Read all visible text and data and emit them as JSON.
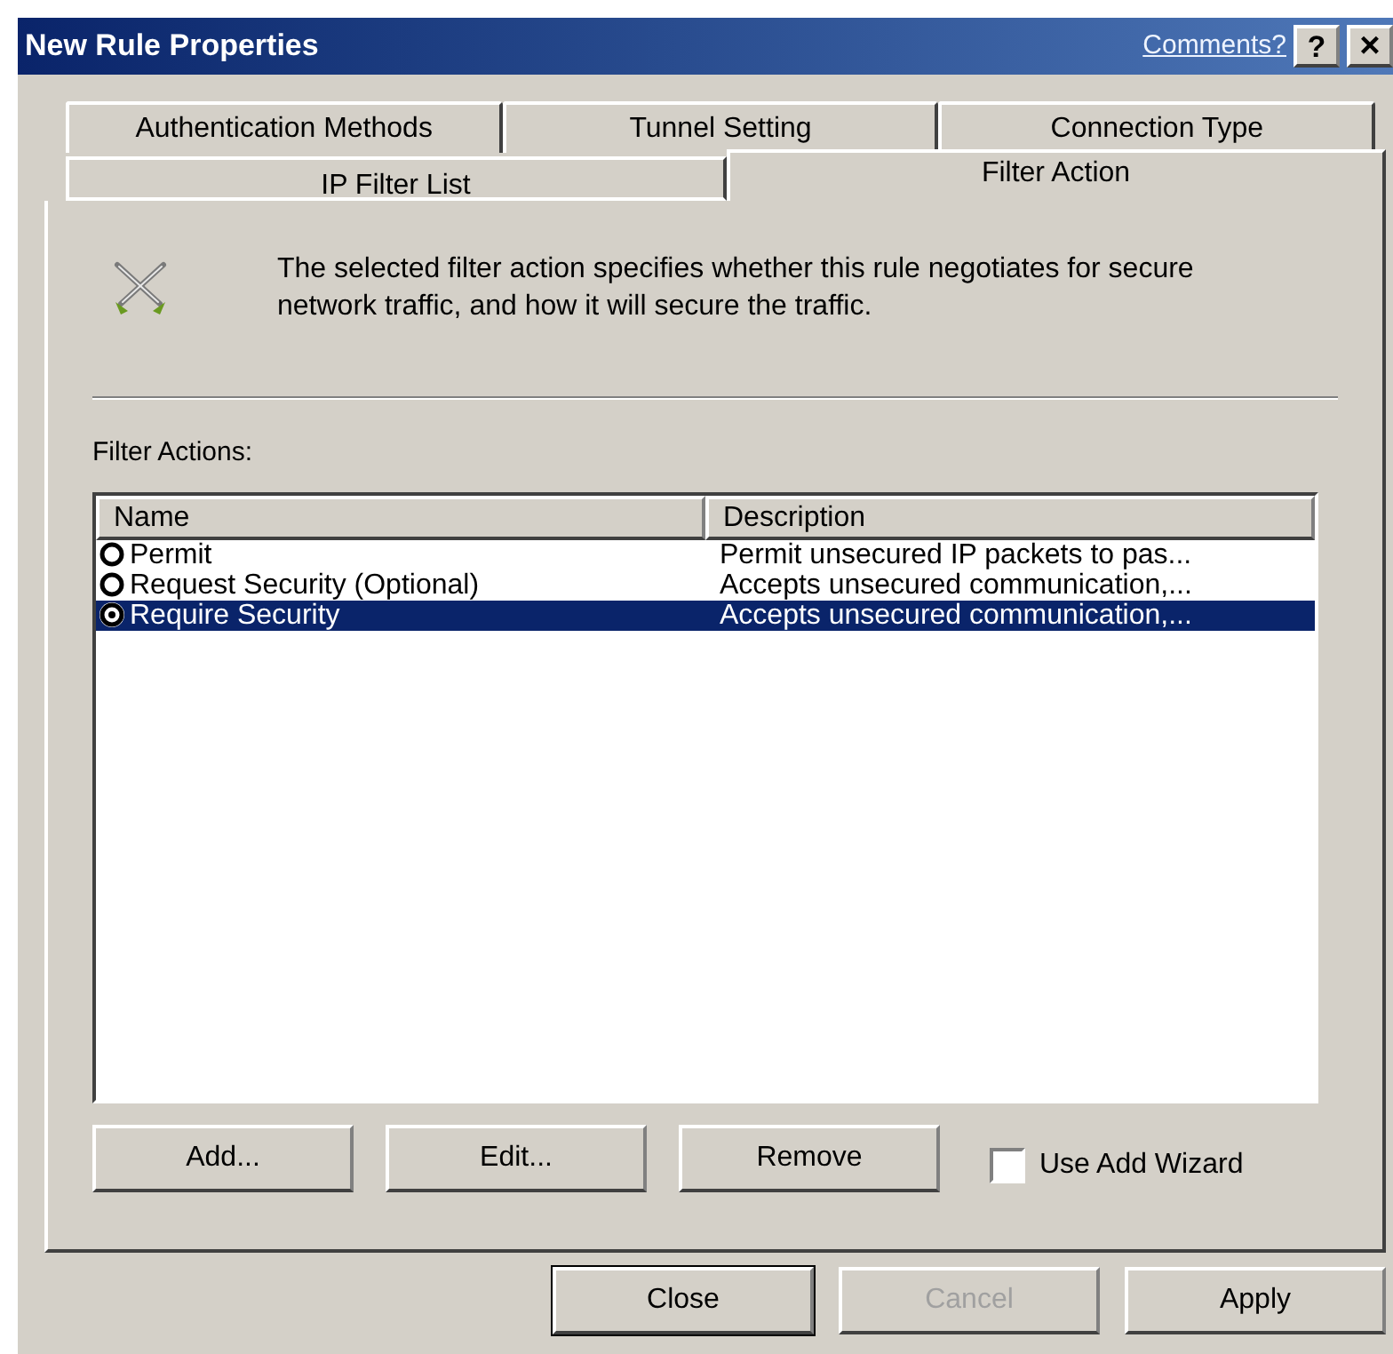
{
  "window": {
    "title": "New Rule Properties",
    "comments_link": "Comments?",
    "help_button": "?",
    "close_button": "×"
  },
  "tabs_back": [
    {
      "label": "Authentication Methods",
      "selected": false
    },
    {
      "label": "Tunnel Setting",
      "selected": false
    },
    {
      "label": "Connection Type",
      "selected": false
    }
  ],
  "tabs_front": [
    {
      "label": "IP Filter List",
      "selected": false
    },
    {
      "label": "Filter Action",
      "selected": true
    }
  ],
  "description": "The selected filter action specifies whether this rule negotiates for secure network traffic, and how it will secure the traffic.",
  "list_label": "Filter Actions:",
  "table": {
    "columns": [
      "Name",
      "Description"
    ],
    "rows": [
      {
        "name": "Permit",
        "description": "Permit unsecured IP packets to pas...",
        "selected": false
      },
      {
        "name": "Request Security (Optional)",
        "description": "Accepts unsecured communication,...",
        "selected": false
      },
      {
        "name": "Require Security",
        "description": "Accepts unsecured communication,...",
        "selected": true
      }
    ]
  },
  "list_buttons": [
    "Add...",
    "Edit...",
    "Remove"
  ],
  "use_add_wizard": {
    "label": "Use Add Wizard",
    "checked": false
  },
  "dialog_buttons": [
    {
      "label": "Close",
      "disabled": false,
      "default": true
    },
    {
      "label": "Cancel",
      "disabled": true,
      "default": false
    },
    {
      "label": "Apply",
      "disabled": false,
      "default": false
    }
  ]
}
